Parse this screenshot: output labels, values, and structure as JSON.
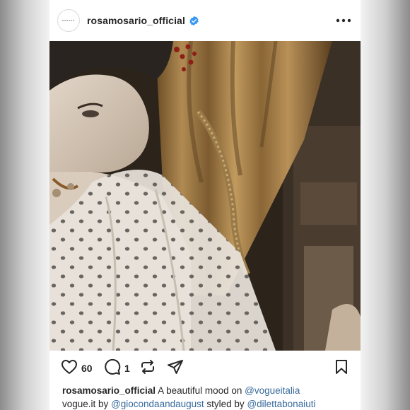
{
  "post": {
    "username": "rosamosario_official",
    "verified": true,
    "like_count": "60",
    "comment_count": "1",
    "caption": {
      "username": "rosamosario_official",
      "text1": "A beautiful mood on",
      "mention1": "@vogueitalia",
      "text2": "vogue.it by",
      "mention2": "@giocondaandaugust",
      "text3": "styled by",
      "mention3": "@dilettabonaiuti"
    }
  },
  "icons": {
    "verified": "verified-badge-icon",
    "more": "more-options-icon",
    "like": "heart-icon",
    "comment": "comment-icon",
    "repost": "repost-icon",
    "share": "send-icon",
    "save": "bookmark-icon"
  },
  "colors": {
    "verified_blue": "#3897f0",
    "mention_blue": "#376a9b",
    "text": "#262626"
  }
}
